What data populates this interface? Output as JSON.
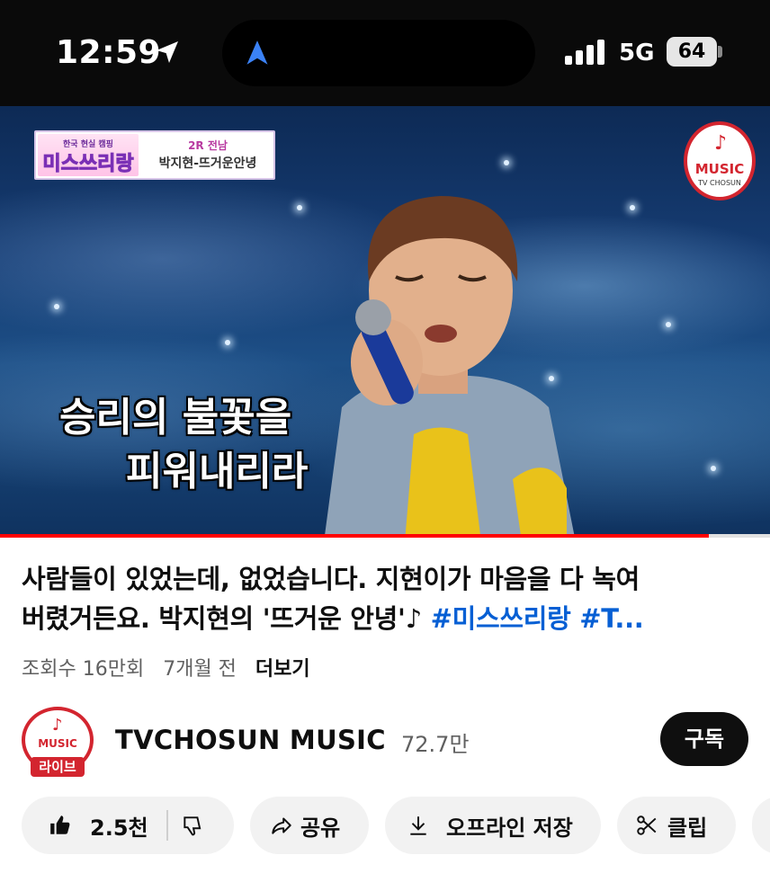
{
  "status_bar": {
    "time": "12:59",
    "network": "5G",
    "battery": "64"
  },
  "video": {
    "show_badge": {
      "logo_top": "한국 현실 캠핑",
      "logo_main": "미스쓰리랑",
      "round": "2R 전남",
      "song": "박지현-뜨거운안녕"
    },
    "channel_logo": {
      "text": "MUSIC",
      "sub": "TV CHOSUN"
    },
    "caption_line1": "승리의 불꽃을",
    "caption_line2": "피워내리라",
    "progress_fraction": 0.92,
    "progress_color": "#ff0000"
  },
  "title": {
    "line1": "사람들이 있었는데, 없었습니다. 지현이가 마음을 다 녹여",
    "line2_text": "버렸거든요. 박지현의 '뜨거운 안녕'♪",
    "line2_tags": "#미스쓰리랑 #T..."
  },
  "meta": {
    "views": "조회수 16만회",
    "age": "7개월 전",
    "more": "더보기"
  },
  "channel": {
    "avatar_text": "MUSIC",
    "avatar_badge": "라이브",
    "name": "TVCHOSUN MUSIC",
    "subscribers": "72.7만",
    "subscribe_label": "구독"
  },
  "actions": {
    "like_count": "2.5천",
    "share": "공유",
    "download": "오프라인 저장",
    "clip": "클립"
  },
  "colors": {
    "accent_red": "#d3252f",
    "link_blue": "#065fd4"
  }
}
